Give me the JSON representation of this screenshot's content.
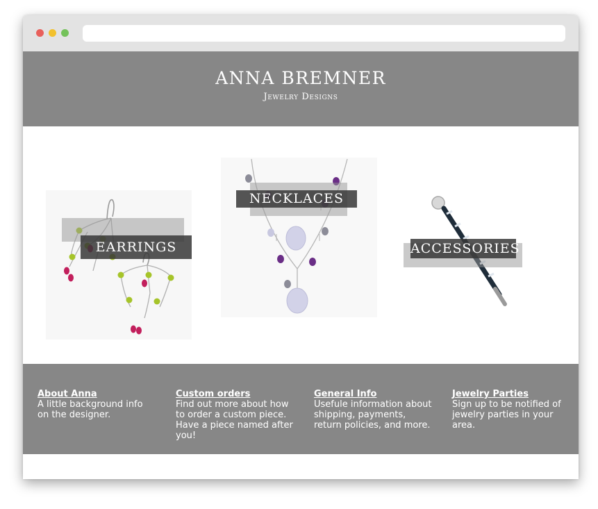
{
  "header": {
    "brand_name": "ANNA BREMNER",
    "brand_sub": "Jewelry Designs"
  },
  "gallery": {
    "items": [
      {
        "label": "EARRINGS",
        "image": "earrings-photo"
      },
      {
        "label": "NECKLACES",
        "image": "necklace-photo"
      },
      {
        "label": "ACCESSORIES",
        "image": "hairpin-photo"
      }
    ]
  },
  "footer": {
    "columns": [
      {
        "title": "About Anna",
        "text": "A little background info on the designer."
      },
      {
        "title": "Custom orders",
        "text": "Find out more about how to order a custom piece. Have a piece named after you!"
      },
      {
        "title": "General Info",
        "text": "Usefule information about shipping, payments, return policies, and more."
      },
      {
        "title": "Jewelry Parties",
        "text": "Sign up to be notified of jewelry parties in your area."
      }
    ]
  },
  "colors": {
    "header_bg": "#878787",
    "footer_bg": "#878787",
    "label_bg": "#373737",
    "peridot": "#a6c42a",
    "amethyst": "#6a2e86",
    "ruby": "#c21f5c",
    "chalcedony": "#d2d2e8"
  }
}
